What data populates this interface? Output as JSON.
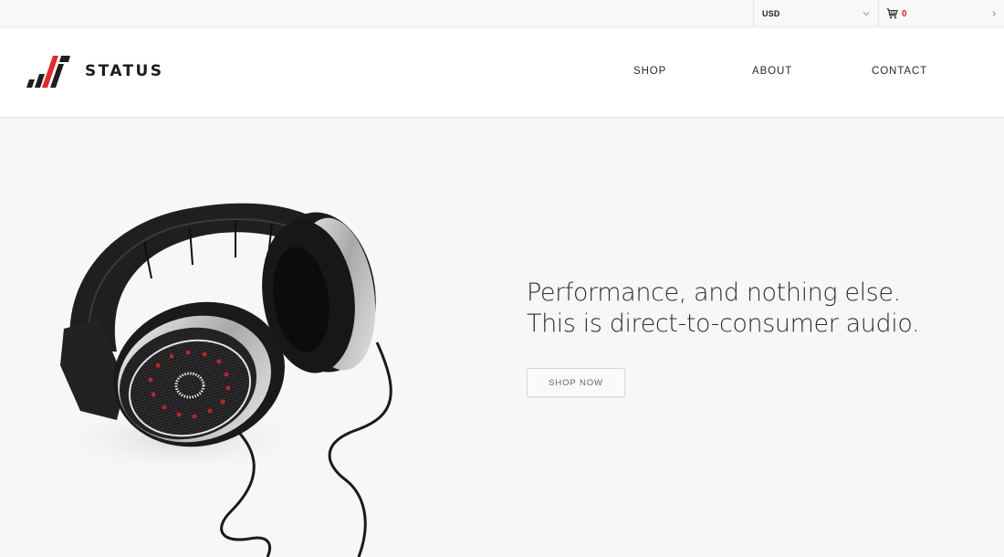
{
  "topbar": {
    "currency": {
      "selected": "USD",
      "icon": "chevron-down-icon"
    },
    "cart": {
      "icon": "cart-icon",
      "count": "0",
      "arrow_icon": "chevron-right-icon",
      "count_color": "#e02020"
    }
  },
  "header": {
    "brand": {
      "name": "STATUS",
      "accent_color": "#e8262b"
    },
    "nav": [
      {
        "label": "SHOP"
      },
      {
        "label": "ABOUT"
      },
      {
        "label": "CONTACT"
      }
    ]
  },
  "hero": {
    "image": "over-ear-headphones-product-photo",
    "headline_lines": [
      "Performance, and nothing else.",
      "This is direct-to-consumer audio."
    ],
    "cta_label": "SHOP NOW"
  }
}
